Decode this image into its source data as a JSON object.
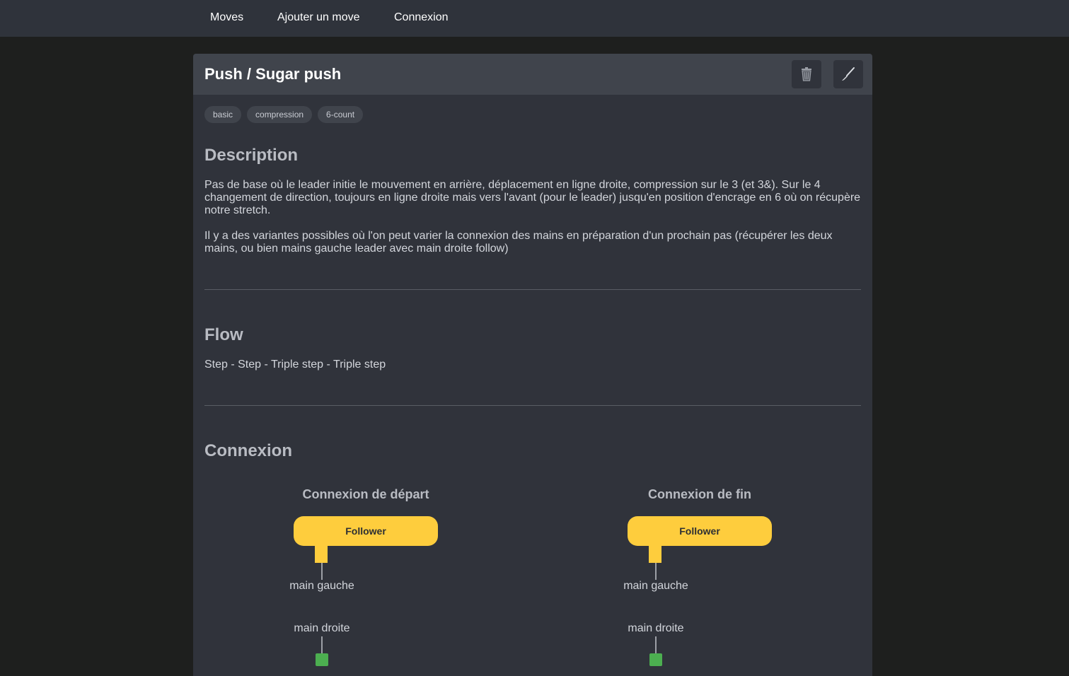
{
  "nav": {
    "moves": "Moves",
    "add_move": "Ajouter un move",
    "login": "Connexion"
  },
  "move": {
    "title": "Push / Sugar push",
    "tags": [
      "basic",
      "compression",
      "6-count"
    ],
    "description_heading": "Description",
    "description_p1": "Pas de base où le leader initie le mouvement en arrière, déplacement en ligne droite, compression sur le 3 (et 3&). Sur le 4 changement de direction, toujours en ligne droite mais vers l'avant (pour le leader) jusqu'en position d'encrage en 6 où on récupère notre stretch.",
    "description_p2": "Il y a des variantes possibles où l'on peut varier la connexion des mains en préparation d'un prochain pas (récupérer les deux mains, ou bien mains gauche leader avec main droite follow)",
    "flow_heading": "Flow",
    "flow_text": "Step - Step - Triple step - Triple step",
    "connexion_heading": "Connexion"
  },
  "connexion": {
    "start": {
      "title": "Connexion de départ",
      "follower_label": "Follower",
      "left_hand": "main gauche",
      "right_hand": "main droite"
    },
    "end": {
      "title": "Connexion de fin",
      "follower_label": "Follower",
      "left_hand": "main gauche",
      "right_hand": "main droite"
    }
  },
  "icons": {
    "delete": "trash-icon",
    "edit": "brush-icon"
  },
  "colors": {
    "follower": "#fecd3d",
    "leader_hand": "#4caf50"
  }
}
